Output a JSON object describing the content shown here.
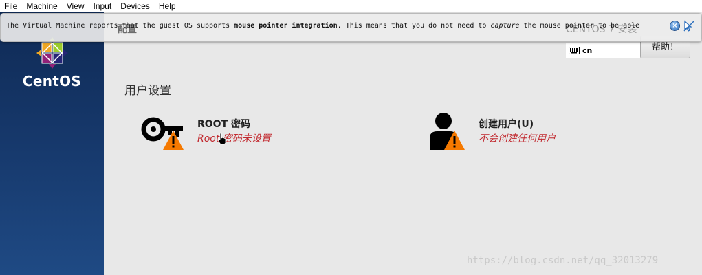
{
  "menu": [
    "File",
    "Machine",
    "View",
    "Input",
    "Devices",
    "Help"
  ],
  "brand": "CentOS",
  "header": {
    "title": "配置",
    "right_text": "CENTOS 7 安装",
    "keyboard_layout": "cn",
    "help_label": "帮助！"
  },
  "notification": {
    "part1": "The Virtual Machine reports that the guest OS supports ",
    "bold": "mouse pointer integration",
    "part2": ". This means that you do not need to ",
    "italic": "capture",
    "part3": " the mouse pointer to be able"
  },
  "section_title": "用户设置",
  "spokes": [
    {
      "title": "ROOT 密码",
      "status": "Root 密码未设置"
    },
    {
      "title": "创建用户(U)",
      "status": "不会创建任何用户"
    }
  ],
  "watermark": "https://blog.csdn.net/qq_32013279",
  "colors": {
    "warning": "#f57900",
    "status_red": "#c1272d",
    "sidebar": "#173a6e"
  }
}
